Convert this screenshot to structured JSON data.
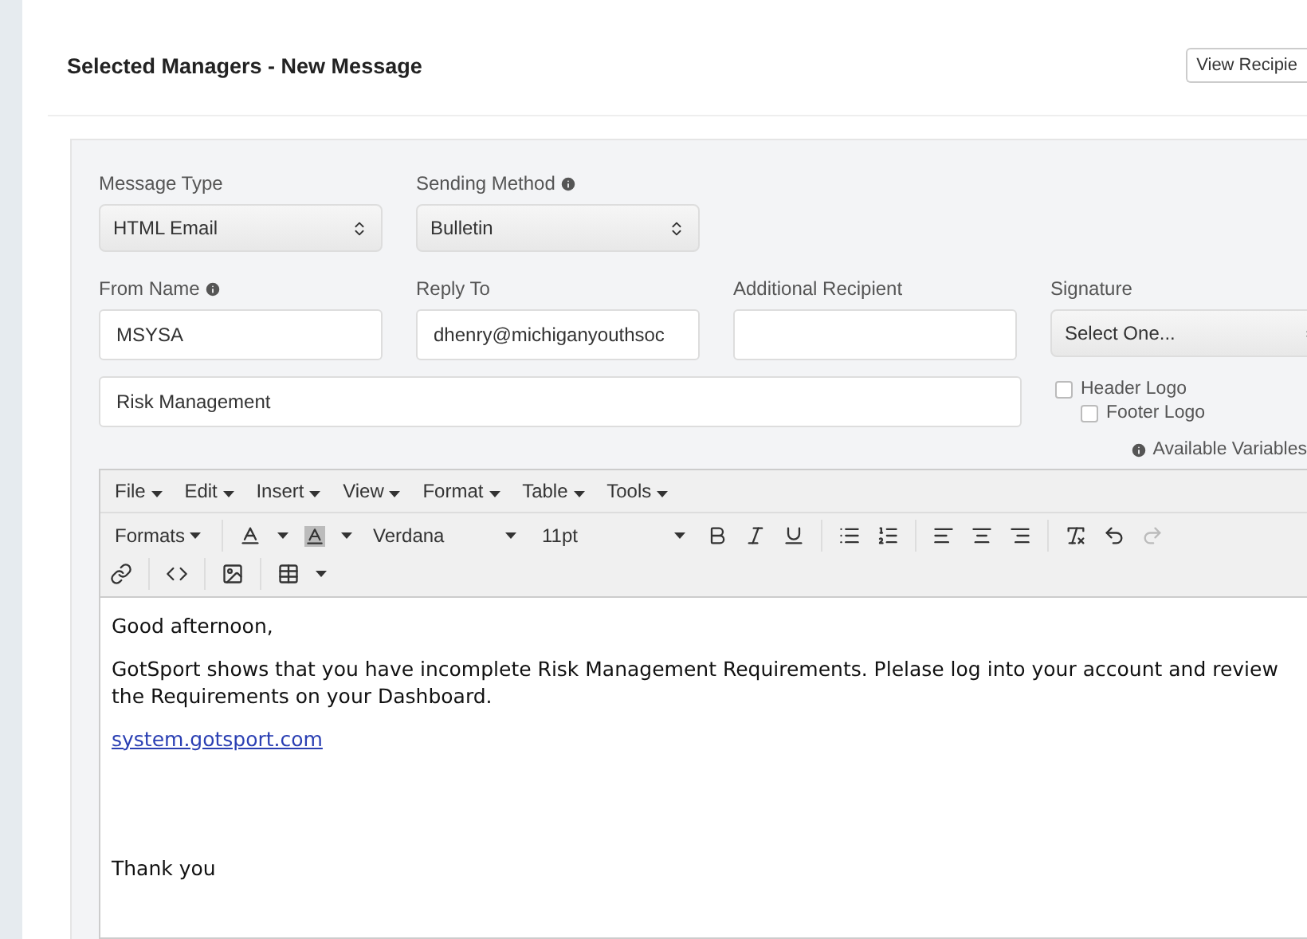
{
  "header": {
    "title": "Selected Managers - New Message",
    "view_button": "View Recipie"
  },
  "row1": [
    {
      "label": "Message Type",
      "info": false,
      "kind": "select",
      "value": "HTML Email"
    },
    {
      "label": "Sending Method",
      "info": true,
      "kind": "select",
      "value": "Bulletin"
    }
  ],
  "row2": [
    {
      "label": "From Name",
      "info": true,
      "kind": "input",
      "value": "MSYSA"
    },
    {
      "label": "Reply To",
      "info": false,
      "kind": "input",
      "value": "dhenry@michiganyouthsoc"
    },
    {
      "label": "Additional Recipient",
      "info": false,
      "kind": "input"
    },
    {
      "label": "Signature",
      "info": false,
      "kind": "select",
      "value": "Select One..."
    }
  ],
  "subject": {
    "value": "Risk Management"
  },
  "logo_options": [
    {
      "label": "Header Logo",
      "checked": false
    },
    {
      "label": "Footer Logo",
      "checked": false
    }
  ],
  "available_variables": "Available Variables",
  "editor": {
    "menus": [
      "File",
      "Edit",
      "Insert",
      "View",
      "Format",
      "Table",
      "Tools"
    ],
    "formats": "Formats",
    "font": "Verdana",
    "size": "11pt",
    "body": [
      {
        "kind": "text",
        "text": "Good afternoon,"
      },
      {
        "kind": "text",
        "text": "GotSport shows that you have incomplete Risk Management Requirements. Plelase log into your account and review the Requirements on your Dashboard."
      },
      {
        "kind": "link",
        "text": "system.gotsport.com"
      },
      {
        "kind": "spacer"
      },
      {
        "kind": "text",
        "text": "Thank you"
      }
    ]
  }
}
